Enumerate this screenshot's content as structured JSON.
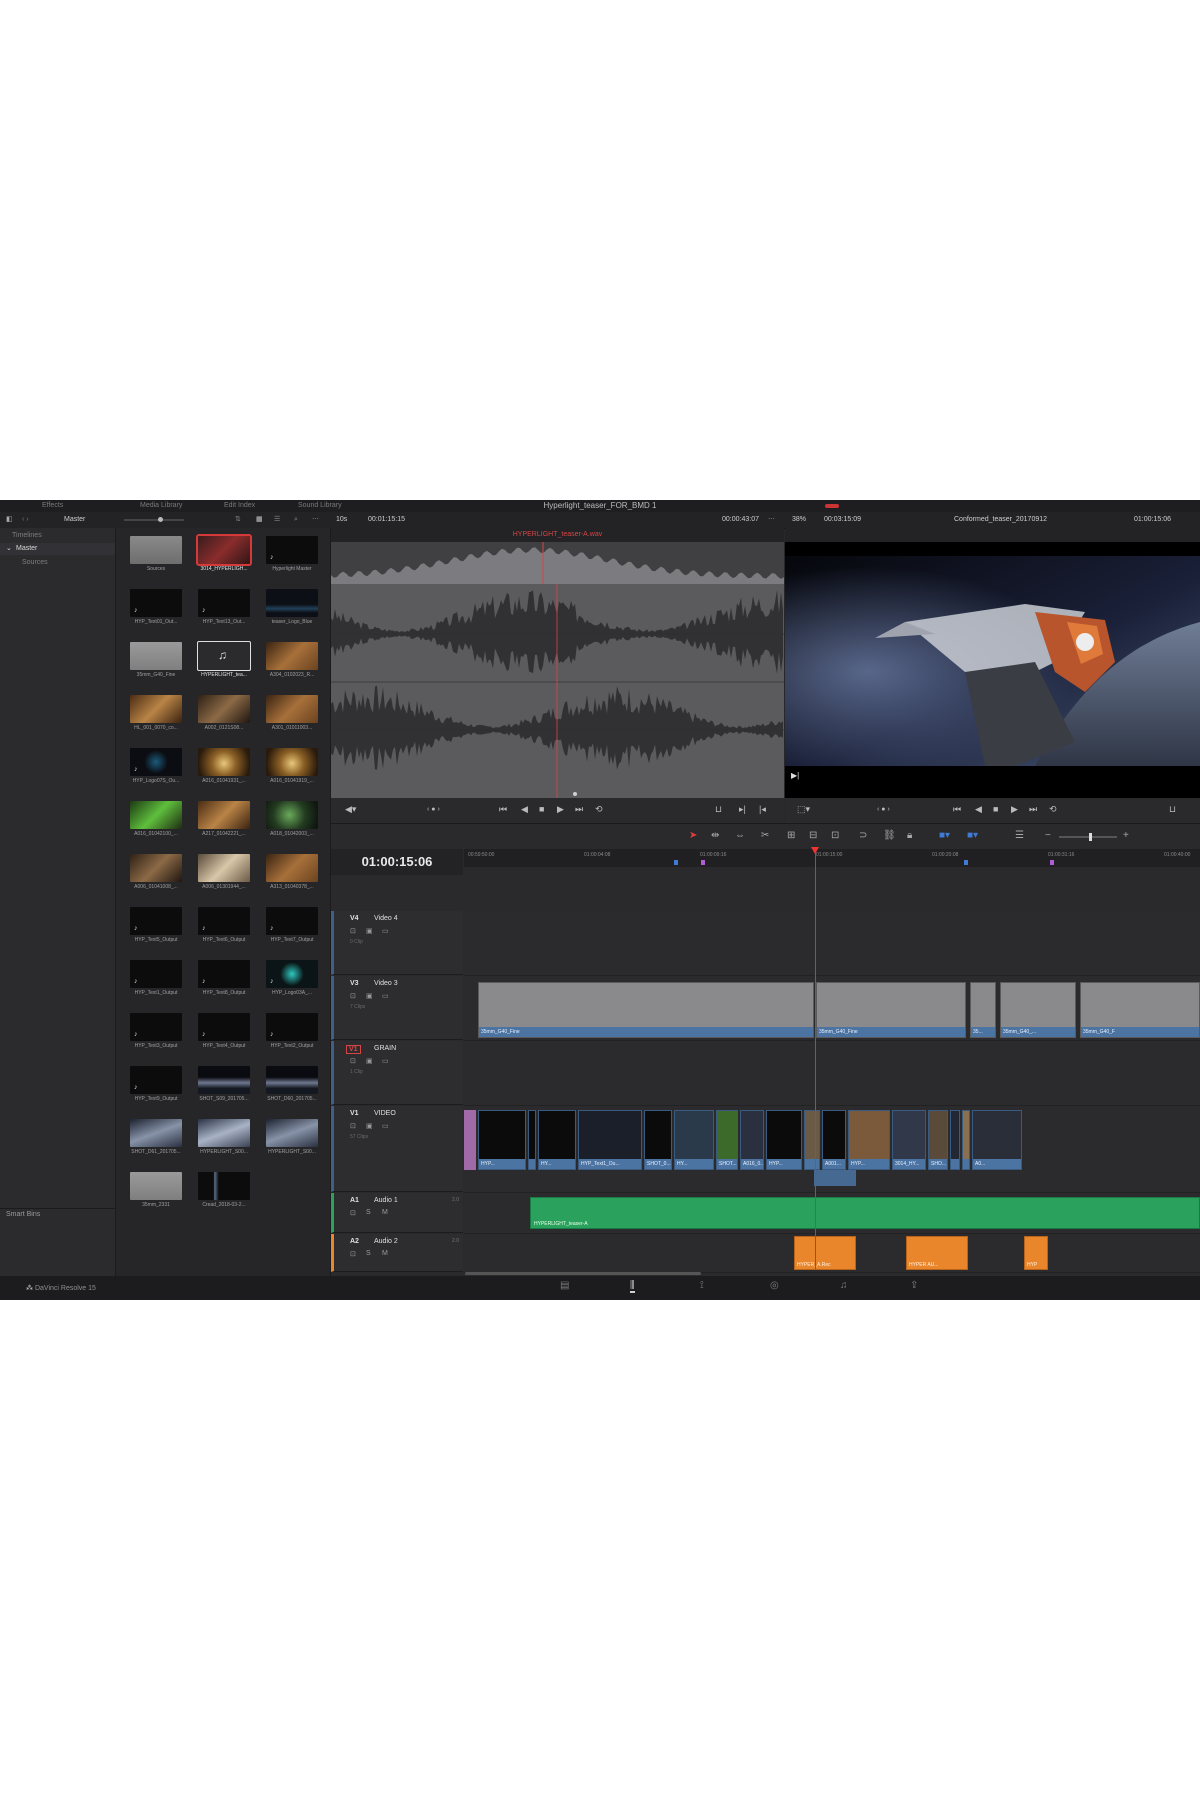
{
  "menu": {
    "left_items": [
      "Effects",
      "Media Library",
      "Edit Index",
      "Sound Library"
    ],
    "project_title": "Hyperlight_teaser_FOR_BMD 1"
  },
  "toolbar": {
    "bin_name": "Master",
    "source_zoom": "10s",
    "source_duration": "00:01:15:15",
    "source_clip_name": "HYPERLIGHT_teaser-A.wav",
    "source_timecode": "00:00:43:07",
    "timeline_zoom": "38%",
    "timeline_duration": "00:03:15:09",
    "timeline_name": "Conformed_teaser_20170912",
    "timeline_timecode": "01:00:15:06"
  },
  "bins": {
    "header": "Timelines",
    "master": "Master",
    "sources": "Sources",
    "smart_bins": "Smart Bins"
  },
  "pool": [
    {
      "name": "Sources",
      "kind": "folder"
    },
    {
      "name": "3014_HYPERLIGH...",
      "kind": "red",
      "selected": true
    },
    {
      "name": "Hyperlight Master",
      "kind": "black"
    },
    {
      "name": "HYP_Text01_Out...",
      "kind": "black"
    },
    {
      "name": "HYP_Text13_Out...",
      "kind": "black"
    },
    {
      "name": "teaser_Logo_Blue",
      "kind": "logo"
    },
    {
      "name": "35mm_G40_Fine",
      "kind": "grey"
    },
    {
      "name": "HYPERLIGHT_tea...",
      "kind": "audio",
      "strong": true
    },
    {
      "name": "A304_0102023_R...",
      "kind": "warm"
    },
    {
      "name": "HL_001_0070_co...",
      "kind": "warm2"
    },
    {
      "name": "A002_0121S08...",
      "kind": "warm3"
    },
    {
      "name": "A301_01011003...",
      "kind": "warm"
    },
    {
      "name": "HYP_Logo07S_Ou...",
      "kind": "logo2"
    },
    {
      "name": "A016_01041931_...",
      "kind": "gold"
    },
    {
      "name": "A016_01041919_...",
      "kind": "gold"
    },
    {
      "name": "A016_01042100_...",
      "kind": "green"
    },
    {
      "name": "A217_01042221_...",
      "kind": "warm2"
    },
    {
      "name": "A018_01042003_...",
      "kind": "green2"
    },
    {
      "name": "A006_01041008_...",
      "kind": "warm3"
    },
    {
      "name": "A006_01301944_...",
      "kind": "pale"
    },
    {
      "name": "A313_01040378_...",
      "kind": "warm"
    },
    {
      "name": "HYP_Text5_Output",
      "kind": "black"
    },
    {
      "name": "HYP_Text6_Output",
      "kind": "black"
    },
    {
      "name": "HYP_Text7_Output",
      "kind": "black"
    },
    {
      "name": "HYP_Text1_Output",
      "kind": "black"
    },
    {
      "name": "HYP_Text8_Output",
      "kind": "black"
    },
    {
      "name": "HYP_Logo03A_...",
      "kind": "logo3"
    },
    {
      "name": "HYP_Text3_Output",
      "kind": "black"
    },
    {
      "name": "HYP_Text4_Output",
      "kind": "black"
    },
    {
      "name": "HYP_Text2_Output",
      "kind": "black"
    },
    {
      "name": "HYP_Text9_Output",
      "kind": "black"
    },
    {
      "name": "SHOT_S09_201705...",
      "kind": "space"
    },
    {
      "name": "SHOT_D60_201705...",
      "kind": "space"
    },
    {
      "name": "SHOT_D61_201705...",
      "kind": "earth"
    },
    {
      "name": "HYPERLIGHT_S00...",
      "kind": "earth2"
    },
    {
      "name": "HYPERLIGHT_S00...",
      "kind": "earth"
    },
    {
      "name": "35mm_2331",
      "kind": "grey"
    },
    {
      "name": "Cread_2018-03-2...",
      "kind": "tall"
    }
  ],
  "timeline": {
    "timecode": "01:00:15:06",
    "ruler": [
      "00:59:50:00",
      "01:00:04:08",
      "01:00:09:16",
      "01:00:15:00",
      "01:00:20:08",
      "01:00:31:16",
      "01:00:40:00"
    ],
    "tracks": [
      {
        "id": "V4",
        "name": "Video 4",
        "sub": "0 Clip"
      },
      {
        "id": "V3",
        "name": "Video 3",
        "sub": "7 Clips"
      },
      {
        "id": "V1",
        "name": "GRAIN",
        "sub": "1 Clip"
      },
      {
        "id": "V1",
        "name": "VIDEO",
        "sub": "57 Clips"
      },
      {
        "id": "A1",
        "name": "Audio 1",
        "sub": "",
        "db": "2.0"
      },
      {
        "id": "A2",
        "name": "Audio 2",
        "sub": "",
        "db": "2.0"
      }
    ],
    "v3_clips": [
      "35mm_G40_Fine",
      "35mm_G40_Fine",
      "35...",
      "35mm_G40_...",
      "35mm_G40_F"
    ],
    "v1_clip_labels": [
      "HYP...",
      "HY...",
      "HYP_Text1_Ou...",
      "SHOT_0...",
      "HY...",
      "SHOT...",
      "A016_0...",
      "HYP...",
      "A001...",
      "HYP...",
      "3014_HY...",
      "SHO...",
      "A0..."
    ],
    "a1_clip": "HYPERLIGHT_teaser-A",
    "a2_clips": [
      "HYPER_A.Rec",
      "HYPER AU...",
      "HYP"
    ]
  },
  "pagebar": {
    "app": "DaVinci Resolve 15"
  },
  "colors": {
    "accent_red": "#d64545",
    "clip_blue": "#4b74a3",
    "audio_green": "#2aa15d",
    "audio_orange": "#e9862b",
    "playhead": "#c23b3b"
  }
}
